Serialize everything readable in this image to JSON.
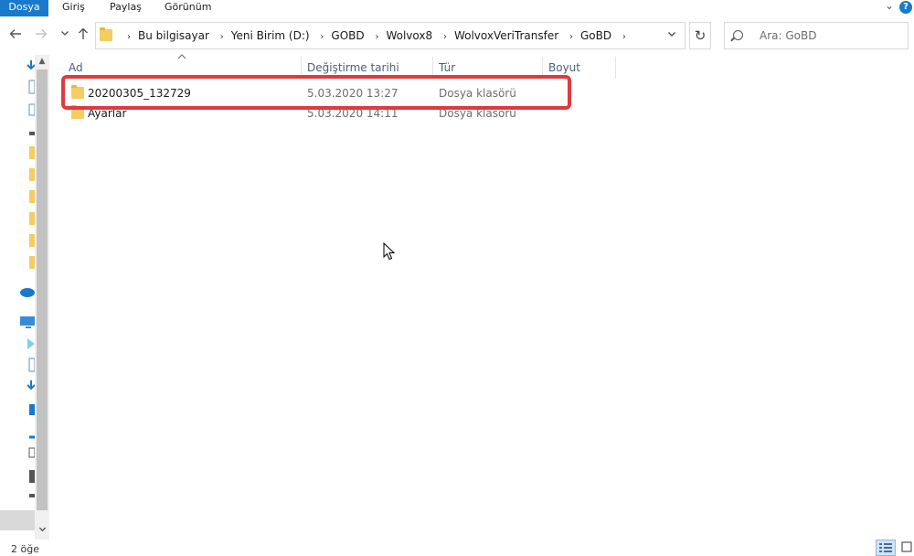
{
  "ribbon": {
    "tabs": [
      "Dosya",
      "Giriş",
      "Paylaş",
      "Görünüm"
    ],
    "expand_icon": "chevron-down-icon",
    "help_label": "?"
  },
  "nav": {
    "back_icon": "arrow-left-icon",
    "forward_icon": "arrow-right-icon",
    "recent_icon": "chevron-down-icon",
    "up_icon": "arrow-up-icon"
  },
  "address": {
    "crumbs": [
      "Bu bilgisayar",
      "Yeni Birim (D:)",
      "GOBD",
      "Wolvox8",
      "WolvoxVeriTransfer",
      "GoBD"
    ],
    "separator": "›",
    "dropdown_glyph": "⌄",
    "refresh_glyph": "↻"
  },
  "search": {
    "placeholder": "Ara: GoBD"
  },
  "columns": {
    "name": "Ad",
    "date": "Değiştirme tarihi",
    "type": "Tür",
    "size": "Boyut"
  },
  "files": [
    {
      "name": "20200305_132729",
      "date": "5.03.2020 13:27",
      "type": "Dosya klasörü",
      "icon": "folder-icon"
    },
    {
      "name": "Ayarlar",
      "date": "5.03.2020 14:11",
      "type": "Dosya klasörü",
      "icon": "folder-icon"
    }
  ],
  "status": {
    "item_count": "2 öğe"
  },
  "colors": {
    "accent": "#1979ca",
    "highlight": "#e0393e",
    "folder": "#f3cd64"
  }
}
